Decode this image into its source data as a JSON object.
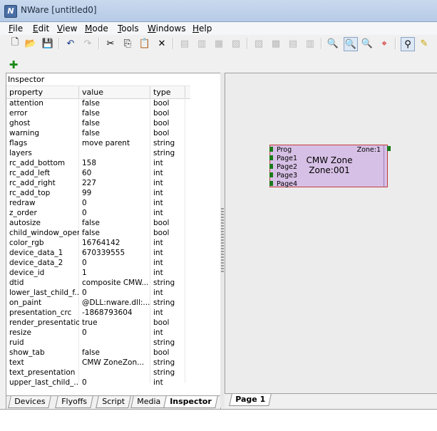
{
  "window": {
    "title": "NWare [untitled0]",
    "icon_letter": "N"
  },
  "menu": [
    {
      "label": "File",
      "u": "F",
      "rest": "ile"
    },
    {
      "label": "Edit",
      "u": "E",
      "rest": "dit"
    },
    {
      "label": "View",
      "u": "V",
      "rest": "iew"
    },
    {
      "label": "Mode",
      "u": "M",
      "rest": "ode"
    },
    {
      "label": "Tools",
      "u": "T",
      "rest": "ools"
    },
    {
      "label": "Windows",
      "u": "W",
      "rest": "indows"
    },
    {
      "label": "Help",
      "u": "H",
      "rest": "elp"
    }
  ],
  "toolbar_icons": [
    "new-file-icon",
    "open-folder-icon",
    "save-icon",
    "undo-icon",
    "redo-icon",
    "cut-icon",
    "copy-icon",
    "paste-icon",
    "delete-icon",
    "align-icons",
    "zoom-out-icon",
    "zoom-fit-icon",
    "zoom-in-icon",
    "zoom-select-icon",
    "select-tool-icon",
    "wire-tool-icon"
  ],
  "inspector": {
    "title": "Inspector",
    "columns": [
      "property",
      "value",
      "type"
    ],
    "rows": [
      [
        "attention",
        "false",
        "bool"
      ],
      [
        "error",
        "false",
        "bool"
      ],
      [
        "ghost",
        "false",
        "bool"
      ],
      [
        "warning",
        "false",
        "bool"
      ],
      [
        "flags",
        "move parent",
        "string"
      ],
      [
        "layers",
        "",
        "string"
      ],
      [
        "rc_add_bottom",
        "158",
        "int"
      ],
      [
        "rc_add_left",
        "60",
        "int"
      ],
      [
        "rc_add_right",
        "227",
        "int"
      ],
      [
        "rc_add_top",
        "99",
        "int"
      ],
      [
        "redraw",
        "0",
        "int"
      ],
      [
        "z_order",
        "0",
        "int"
      ],
      [
        "autosize",
        "false",
        "bool"
      ],
      [
        "child_window_open",
        "false",
        "bool"
      ],
      [
        "color_rgb",
        "16764142",
        "int"
      ],
      [
        "device_data_1",
        "670339555",
        "int"
      ],
      [
        "device_data_2",
        "0",
        "int"
      ],
      [
        "device_id",
        "1",
        "int"
      ],
      [
        "dtid",
        "composite CMW...",
        "string"
      ],
      [
        "lower_last_child_f...",
        "0",
        "int"
      ],
      [
        "on_paint",
        "@DLL:nware.dll:...",
        "string"
      ],
      [
        "presentation_crc",
        "-1868793604",
        "int"
      ],
      [
        "render_presentation",
        "true",
        "bool"
      ],
      [
        "resize",
        "0",
        "int"
      ],
      [
        "ruid",
        "",
        "string"
      ],
      [
        "show_tab",
        "false",
        "bool"
      ],
      [
        "text",
        "CMW ZoneZon...",
        "string"
      ],
      [
        "text_presentation",
        "",
        "string"
      ],
      [
        "upper_last_child_...",
        "0",
        "int"
      ]
    ]
  },
  "left_tabs": [
    "Devices",
    "Flyoffs",
    "Script",
    "Media",
    "Inspector"
  ],
  "right_tabs": [
    "Page 1"
  ],
  "zone_block": {
    "ports_in": [
      "Prog",
      "Page1",
      "Page2",
      "Page3",
      "Page4"
    ],
    "port_out": "Zone:1",
    "title_line1": "CMW Zone",
    "title_line2": "Zone:001"
  },
  "colors": {
    "zone_fill": "#d7c0e6",
    "zone_border": "#c23b3b",
    "pin": "#1a7a1a"
  }
}
